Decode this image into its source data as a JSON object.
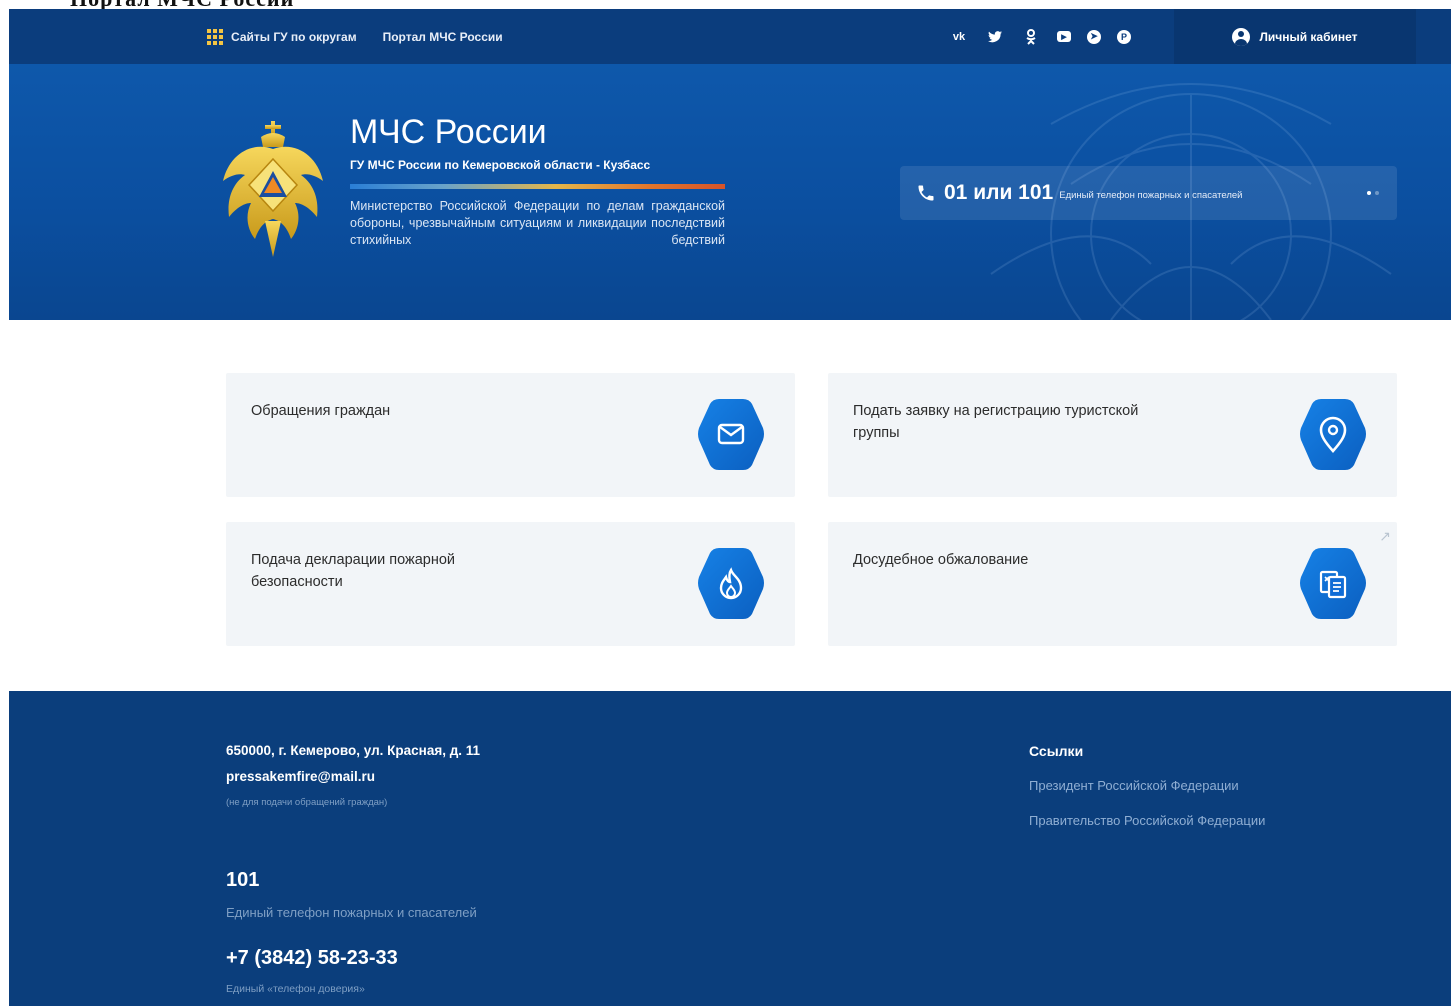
{
  "top_strip": {
    "text": "Портал МЧС России"
  },
  "topbar": {
    "districts_label": "Сайты ГУ по округам",
    "portal_label": "Портал МЧС России",
    "socials": [
      {
        "icon": "vk-icon",
        "glyph": "vk"
      },
      {
        "icon": "twitter-icon",
        "glyph": "🐦"
      },
      {
        "icon": "odnoklassniki-icon",
        "glyph": "ok"
      },
      {
        "icon": "youtube-icon",
        "glyph": "▶"
      },
      {
        "icon": "telegram-icon",
        "glyph": "➤"
      },
      {
        "icon": "pinterest-icon",
        "glyph": "P"
      }
    ],
    "cabinet_label": "Личный кабинет"
  },
  "hero": {
    "title": "МЧС России",
    "subtitle": "ГУ МЧС России по Кемеровской области - Кузбасс",
    "description": "Министерство Российской Федерации по делам гражданской обороны, чрезвычайным ситуациям и ликвидации последствий стихийных бедствий",
    "phone_number": "01 или 101",
    "phone_label": "Единый телефон пожарных и спасателей"
  },
  "services": [
    {
      "label": "Обращения граждан",
      "icon": "mail-icon"
    },
    {
      "label": "Подать заявку на регистрацию туристской группы",
      "icon": "map-pin-icon"
    },
    {
      "label": "Подача декларации пожарной безопасности",
      "icon": "fire-icon"
    },
    {
      "label": "Досудебное обжалование",
      "icon": "document-icon"
    }
  ],
  "footer": {
    "address": "650000, г. Кемерово, ул. Красная, д. 11",
    "email": "pressakemfire@mail.ru",
    "email_note": "(не для подачи обращений граждан)",
    "phone1": "101",
    "phone1_caption": "Единый телефон пожарных и спасателей",
    "phone2": "+7 (3842) 58-23-33",
    "phone2_caption": "Единый «телефон доверия»",
    "links_title": "Ссылки",
    "links": [
      "Президент Российской Федерации",
      "Правительство Российской Федерации"
    ]
  },
  "colors": {
    "topbar": "#0b3d7d",
    "hero": "#0e58ab",
    "accent_hex": "#0f6cd6",
    "card_bg": "#f2f5f8",
    "footer": "#0b3e7c"
  }
}
